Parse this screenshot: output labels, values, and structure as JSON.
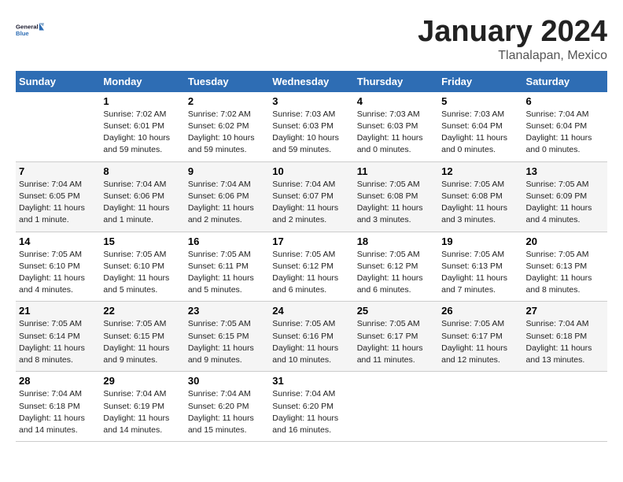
{
  "logo": {
    "text_general": "General",
    "text_blue": "Blue"
  },
  "title": "January 2024",
  "location": "Tlanalapan, Mexico",
  "weekdays": [
    "Sunday",
    "Monday",
    "Tuesday",
    "Wednesday",
    "Thursday",
    "Friday",
    "Saturday"
  ],
  "weeks": [
    [
      {
        "day": "",
        "sunrise": "",
        "sunset": "",
        "daylight": ""
      },
      {
        "day": "1",
        "sunrise": "Sunrise: 7:02 AM",
        "sunset": "Sunset: 6:01 PM",
        "daylight": "Daylight: 10 hours and 59 minutes."
      },
      {
        "day": "2",
        "sunrise": "Sunrise: 7:02 AM",
        "sunset": "Sunset: 6:02 PM",
        "daylight": "Daylight: 10 hours and 59 minutes."
      },
      {
        "day": "3",
        "sunrise": "Sunrise: 7:03 AM",
        "sunset": "Sunset: 6:03 PM",
        "daylight": "Daylight: 10 hours and 59 minutes."
      },
      {
        "day": "4",
        "sunrise": "Sunrise: 7:03 AM",
        "sunset": "Sunset: 6:03 PM",
        "daylight": "Daylight: 11 hours and 0 minutes."
      },
      {
        "day": "5",
        "sunrise": "Sunrise: 7:03 AM",
        "sunset": "Sunset: 6:04 PM",
        "daylight": "Daylight: 11 hours and 0 minutes."
      },
      {
        "day": "6",
        "sunrise": "Sunrise: 7:04 AM",
        "sunset": "Sunset: 6:04 PM",
        "daylight": "Daylight: 11 hours and 0 minutes."
      }
    ],
    [
      {
        "day": "7",
        "sunrise": "Sunrise: 7:04 AM",
        "sunset": "Sunset: 6:05 PM",
        "daylight": "Daylight: 11 hours and 1 minute."
      },
      {
        "day": "8",
        "sunrise": "Sunrise: 7:04 AM",
        "sunset": "Sunset: 6:06 PM",
        "daylight": "Daylight: 11 hours and 1 minute."
      },
      {
        "day": "9",
        "sunrise": "Sunrise: 7:04 AM",
        "sunset": "Sunset: 6:06 PM",
        "daylight": "Daylight: 11 hours and 2 minutes."
      },
      {
        "day": "10",
        "sunrise": "Sunrise: 7:04 AM",
        "sunset": "Sunset: 6:07 PM",
        "daylight": "Daylight: 11 hours and 2 minutes."
      },
      {
        "day": "11",
        "sunrise": "Sunrise: 7:05 AM",
        "sunset": "Sunset: 6:08 PM",
        "daylight": "Daylight: 11 hours and 3 minutes."
      },
      {
        "day": "12",
        "sunrise": "Sunrise: 7:05 AM",
        "sunset": "Sunset: 6:08 PM",
        "daylight": "Daylight: 11 hours and 3 minutes."
      },
      {
        "day": "13",
        "sunrise": "Sunrise: 7:05 AM",
        "sunset": "Sunset: 6:09 PM",
        "daylight": "Daylight: 11 hours and 4 minutes."
      }
    ],
    [
      {
        "day": "14",
        "sunrise": "Sunrise: 7:05 AM",
        "sunset": "Sunset: 6:10 PM",
        "daylight": "Daylight: 11 hours and 4 minutes."
      },
      {
        "day": "15",
        "sunrise": "Sunrise: 7:05 AM",
        "sunset": "Sunset: 6:10 PM",
        "daylight": "Daylight: 11 hours and 5 minutes."
      },
      {
        "day": "16",
        "sunrise": "Sunrise: 7:05 AM",
        "sunset": "Sunset: 6:11 PM",
        "daylight": "Daylight: 11 hours and 5 minutes."
      },
      {
        "day": "17",
        "sunrise": "Sunrise: 7:05 AM",
        "sunset": "Sunset: 6:12 PM",
        "daylight": "Daylight: 11 hours and 6 minutes."
      },
      {
        "day": "18",
        "sunrise": "Sunrise: 7:05 AM",
        "sunset": "Sunset: 6:12 PM",
        "daylight": "Daylight: 11 hours and 6 minutes."
      },
      {
        "day": "19",
        "sunrise": "Sunrise: 7:05 AM",
        "sunset": "Sunset: 6:13 PM",
        "daylight": "Daylight: 11 hours and 7 minutes."
      },
      {
        "day": "20",
        "sunrise": "Sunrise: 7:05 AM",
        "sunset": "Sunset: 6:13 PM",
        "daylight": "Daylight: 11 hours and 8 minutes."
      }
    ],
    [
      {
        "day": "21",
        "sunrise": "Sunrise: 7:05 AM",
        "sunset": "Sunset: 6:14 PM",
        "daylight": "Daylight: 11 hours and 8 minutes."
      },
      {
        "day": "22",
        "sunrise": "Sunrise: 7:05 AM",
        "sunset": "Sunset: 6:15 PM",
        "daylight": "Daylight: 11 hours and 9 minutes."
      },
      {
        "day": "23",
        "sunrise": "Sunrise: 7:05 AM",
        "sunset": "Sunset: 6:15 PM",
        "daylight": "Daylight: 11 hours and 9 minutes."
      },
      {
        "day": "24",
        "sunrise": "Sunrise: 7:05 AM",
        "sunset": "Sunset: 6:16 PM",
        "daylight": "Daylight: 11 hours and 10 minutes."
      },
      {
        "day": "25",
        "sunrise": "Sunrise: 7:05 AM",
        "sunset": "Sunset: 6:17 PM",
        "daylight": "Daylight: 11 hours and 11 minutes."
      },
      {
        "day": "26",
        "sunrise": "Sunrise: 7:05 AM",
        "sunset": "Sunset: 6:17 PM",
        "daylight": "Daylight: 11 hours and 12 minutes."
      },
      {
        "day": "27",
        "sunrise": "Sunrise: 7:04 AM",
        "sunset": "Sunset: 6:18 PM",
        "daylight": "Daylight: 11 hours and 13 minutes."
      }
    ],
    [
      {
        "day": "28",
        "sunrise": "Sunrise: 7:04 AM",
        "sunset": "Sunset: 6:18 PM",
        "daylight": "Daylight: 11 hours and 14 minutes."
      },
      {
        "day": "29",
        "sunrise": "Sunrise: 7:04 AM",
        "sunset": "Sunset: 6:19 PM",
        "daylight": "Daylight: 11 hours and 14 minutes."
      },
      {
        "day": "30",
        "sunrise": "Sunrise: 7:04 AM",
        "sunset": "Sunset: 6:20 PM",
        "daylight": "Daylight: 11 hours and 15 minutes."
      },
      {
        "day": "31",
        "sunrise": "Sunrise: 7:04 AM",
        "sunset": "Sunset: 6:20 PM",
        "daylight": "Daylight: 11 hours and 16 minutes."
      },
      {
        "day": "",
        "sunrise": "",
        "sunset": "",
        "daylight": ""
      },
      {
        "day": "",
        "sunrise": "",
        "sunset": "",
        "daylight": ""
      },
      {
        "day": "",
        "sunrise": "",
        "sunset": "",
        "daylight": ""
      }
    ]
  ]
}
